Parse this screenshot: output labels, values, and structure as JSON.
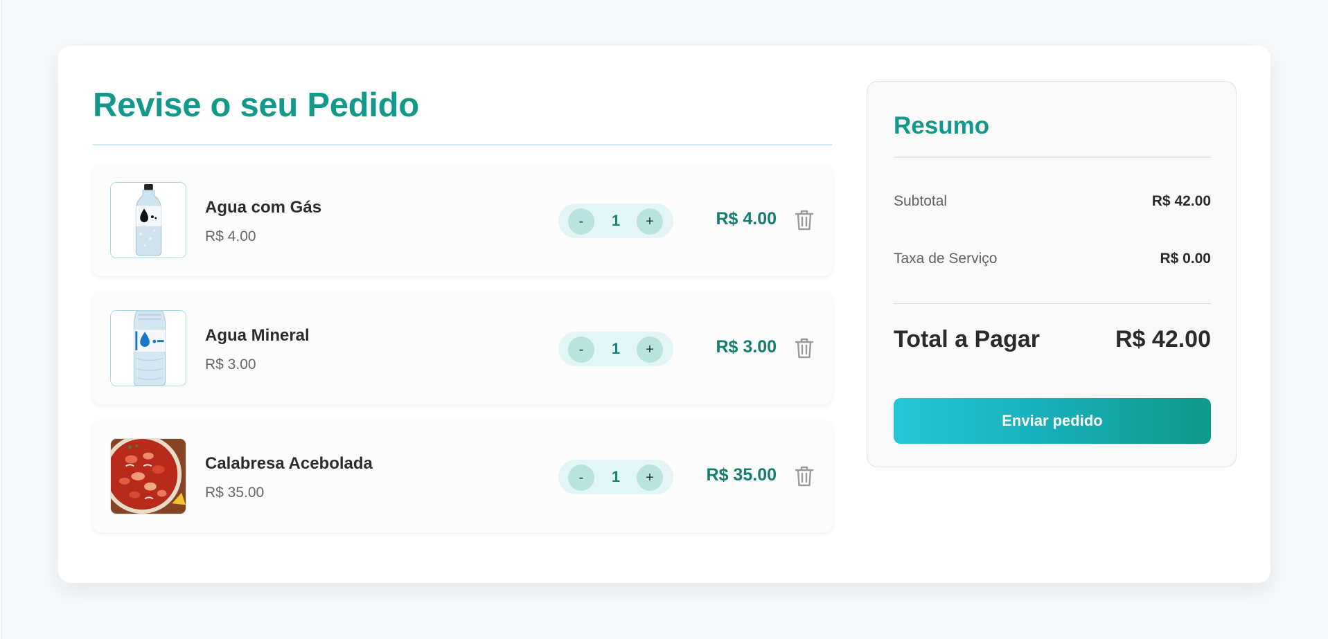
{
  "order": {
    "title": "Revise o seu Pedido",
    "items": [
      {
        "name": "Agua com Gás",
        "unit_price": "R$ 4.00",
        "quantity": "1",
        "minus_label": "-",
        "plus_label": "+",
        "line_total": "R$ 4.00",
        "image": "sparkling-water-bottle"
      },
      {
        "name": "Agua Mineral",
        "unit_price": "R$ 3.00",
        "quantity": "1",
        "minus_label": "-",
        "plus_label": "+",
        "line_total": "R$ 3.00",
        "image": "mineral-water-bottle"
      },
      {
        "name": "Calabresa Acebolada",
        "unit_price": "R$ 35.00",
        "quantity": "1",
        "minus_label": "-",
        "plus_label": "+",
        "line_total": "R$ 35.00",
        "image": "calabresa-dish"
      }
    ],
    "remove_icon": "trash-icon"
  },
  "summary": {
    "title": "Resumo",
    "subtotal_label": "Subtotal",
    "subtotal_value": "R$ 42.00",
    "fee_label": "Taxa de Serviço",
    "fee_value": "R$ 0.00",
    "total_label": "Total a Pagar",
    "total_value": "R$ 42.00",
    "submit_label": "Enviar pedido"
  },
  "colors": {
    "accent": "#13998a",
    "price": "#137d70",
    "button_gradient_start": "#25c5d6",
    "button_gradient_end": "#0e9a89"
  }
}
